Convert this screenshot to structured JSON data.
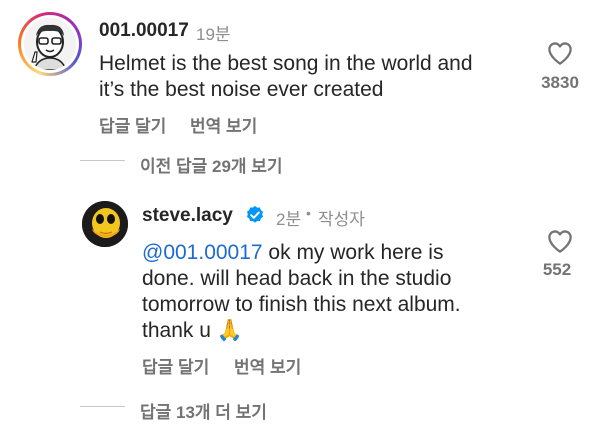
{
  "comment1": {
    "username": "001.00017",
    "time": "19분",
    "text_line1": "Helmet is the best song in the world and",
    "text_line2": "it’s the best noise ever created",
    "reply_label": "답글 달기",
    "translate_label": "번역 보기",
    "likes": "3830",
    "view_previous_replies": "이전 답글 29개 보기"
  },
  "reply1": {
    "username": "steve.lacy",
    "verified": true,
    "time": "2분",
    "separator": "•",
    "author_label": "작성자",
    "mention": "@001.00017",
    "text_line1_rest": " ok my work here is",
    "text_line2": "done. will head back in the studio",
    "text_line3": "tomorrow to finish this next album.",
    "text_line4": "thank u",
    "emoji": "🙏",
    "reply_label": "답글 달기",
    "translate_label": "번역 보기",
    "likes": "552",
    "view_more_replies": "답글 13개 더 보기"
  },
  "colors": {
    "text": "#262626",
    "secondary": "#737373",
    "mention": "#1d6bd1",
    "verified": "#0095f6"
  },
  "icons": [
    "heart-outline-icon",
    "verified-badge-icon"
  ]
}
